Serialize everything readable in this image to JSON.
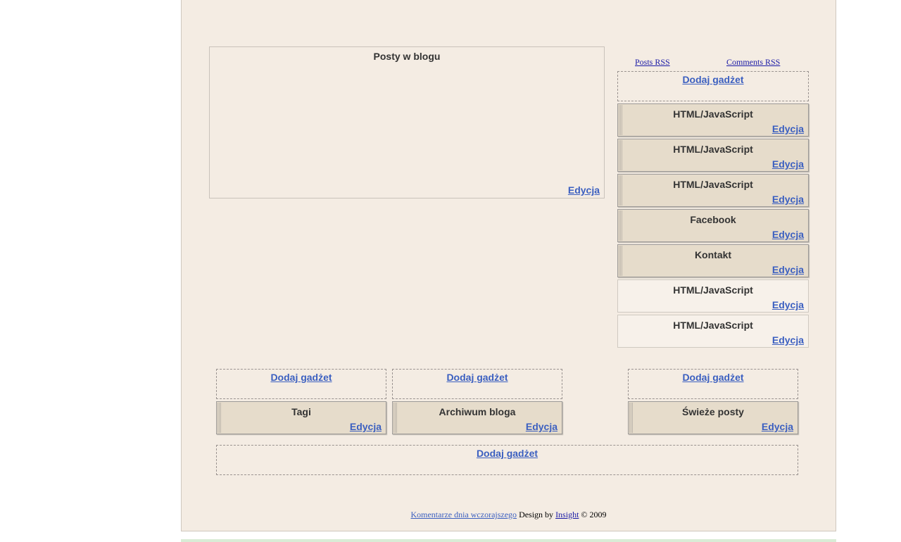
{
  "main": {
    "posts_title": "Posty w blogu",
    "posts_edit": "Edycja"
  },
  "feeds": {
    "posts_rss": "Posts RSS",
    "comments_rss": "Comments RSS"
  },
  "sidebar": {
    "add_gadget": "Dodaj gadżet",
    "gadgets": [
      {
        "title": "HTML/JavaScript",
        "edit": "Edycja"
      },
      {
        "title": "HTML/JavaScript",
        "edit": "Edycja"
      },
      {
        "title": "HTML/JavaScript",
        "edit": "Edycja"
      },
      {
        "title": "Facebook",
        "edit": "Edycja"
      },
      {
        "title": "Kontakt",
        "edit": "Edycja"
      },
      {
        "title": "HTML/JavaScript",
        "edit": "Edycja"
      },
      {
        "title": "HTML/JavaScript",
        "edit": "Edycja"
      }
    ]
  },
  "bottom": {
    "columns": [
      {
        "add_gadget": "Dodaj gadżet",
        "title": "Tagi",
        "edit": "Edycja"
      },
      {
        "add_gadget": "Dodaj gadżet",
        "title": "Archiwum bloga",
        "edit": "Edycja"
      },
      {
        "add_gadget": "Dodaj gadżet",
        "title": "Świeże posty",
        "edit": "Edycja"
      }
    ],
    "wide_add_gadget": "Dodaj gadżet"
  },
  "footer": {
    "link1": "Komentarze dnia wczorajszego",
    "design_by": " Design by ",
    "link2": "Insight",
    "copyright": " © 2009"
  }
}
